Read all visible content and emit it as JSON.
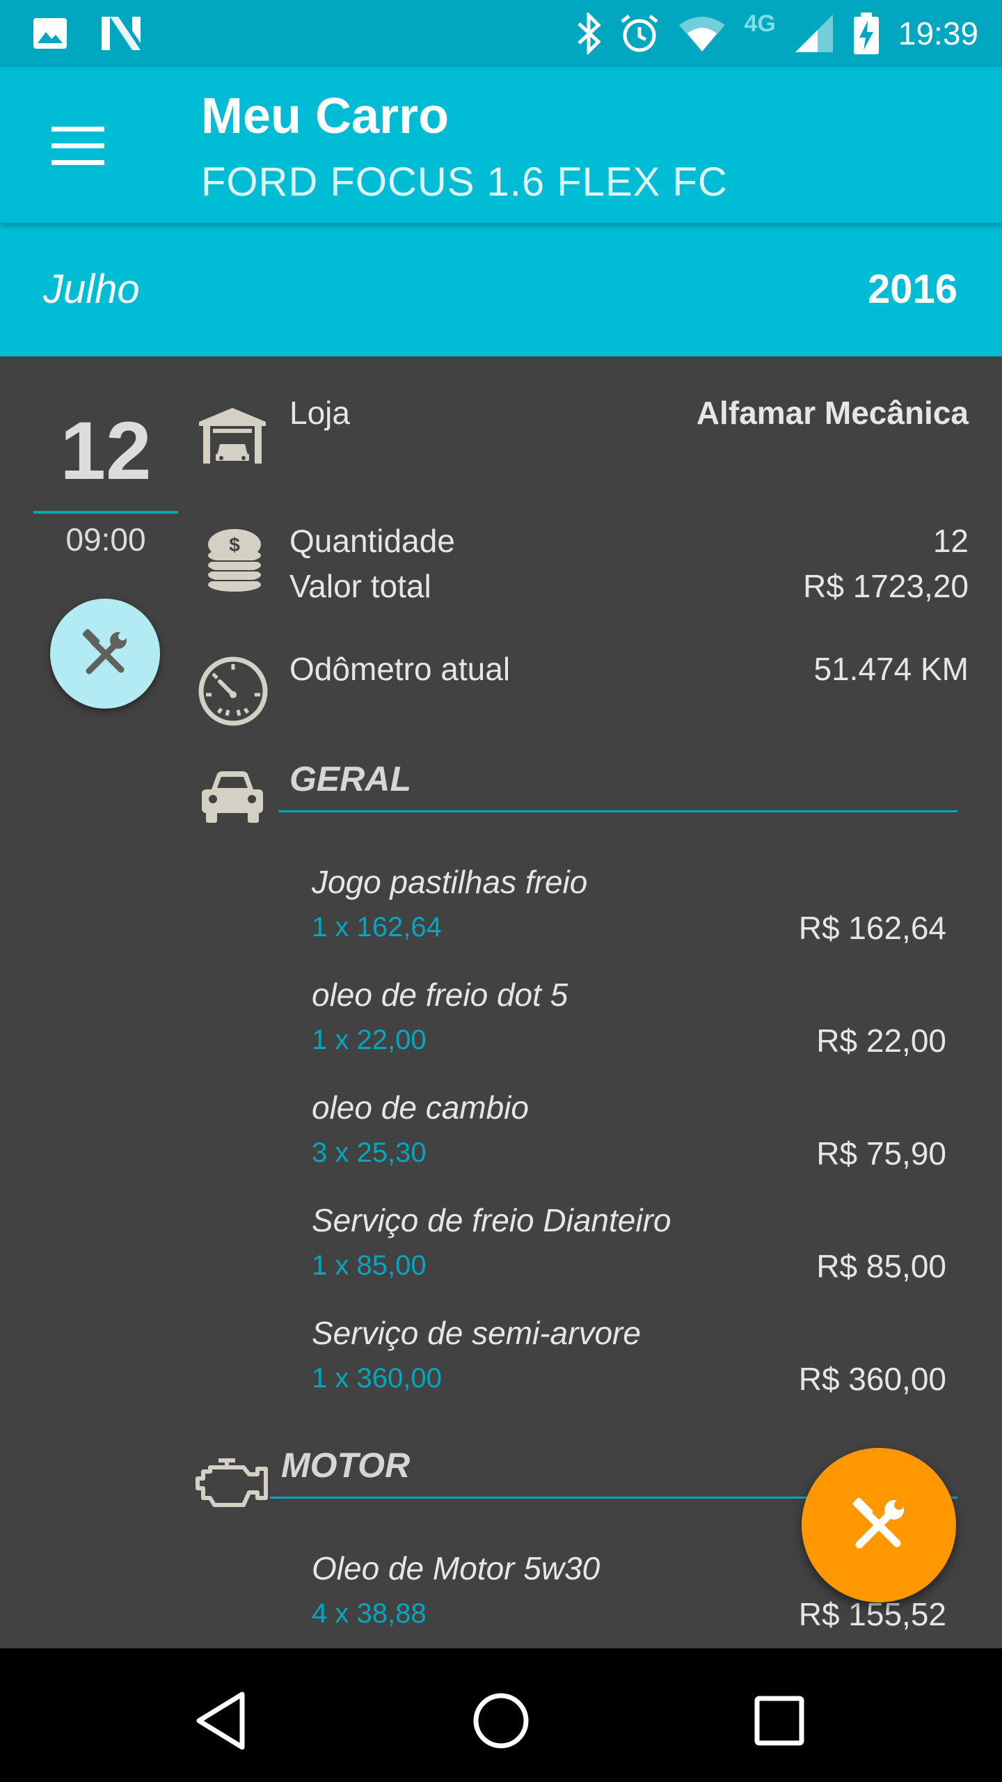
{
  "status_bar": {
    "time": "19:39",
    "network": "4G",
    "icons": [
      "image-icon",
      "n-logo-icon",
      "bluetooth-icon",
      "alarm-icon",
      "wifi-icon",
      "signal-icon",
      "battery-charging-icon"
    ]
  },
  "app_bar": {
    "title": "Meu Carro",
    "subtitle": "FORD FOCUS 1.6 FLEX FC",
    "menu_icon": "hamburger-menu-icon"
  },
  "period": {
    "month": "Julho",
    "year": "2016"
  },
  "entry": {
    "day": "12",
    "time": "09:00",
    "type_icon": "tools-icon",
    "store_label": "Loja",
    "store_value": "Alfamar Mecânica",
    "quantity_label": "Quantidade",
    "quantity_value": "12",
    "total_label": "Valor total",
    "total_value": "R$ 1723,20",
    "odometer_label": "Odômetro atual",
    "odometer_value": "51.474 KM"
  },
  "sections": [
    {
      "title": "GERAL",
      "icon": "car-icon",
      "items": [
        {
          "name": "Jogo pastilhas freio",
          "qty": "1 x 162,64",
          "total": "R$ 162,64"
        },
        {
          "name": "oleo de freio dot 5",
          "qty": "1 x 22,00",
          "total": "R$ 22,00"
        },
        {
          "name": "oleo de cambio",
          "qty": "3 x 25,30",
          "total": "R$ 75,90"
        },
        {
          "name": "Serviço de freio Dianteiro",
          "qty": "1 x 85,00",
          "total": "R$ 85,00"
        },
        {
          "name": "Serviço de semi-arvore",
          "qty": "1 x 360,00",
          "total": "R$ 360,00"
        }
      ]
    },
    {
      "title": "MOTOR",
      "icon": "engine-icon",
      "items": [
        {
          "name": "Oleo de Motor 5w30",
          "qty": "4 x 38,88",
          "total": "R$ 155,52"
        }
      ]
    }
  ],
  "colors": {
    "primary": "#00bcd4",
    "primary_dark": "#00a7bf",
    "background": "#424242",
    "accent": "#ff9800",
    "tools_circle": "#b2ebf2"
  },
  "nav_bar": {
    "icons": [
      "back-icon",
      "home-icon",
      "recents-icon"
    ]
  }
}
